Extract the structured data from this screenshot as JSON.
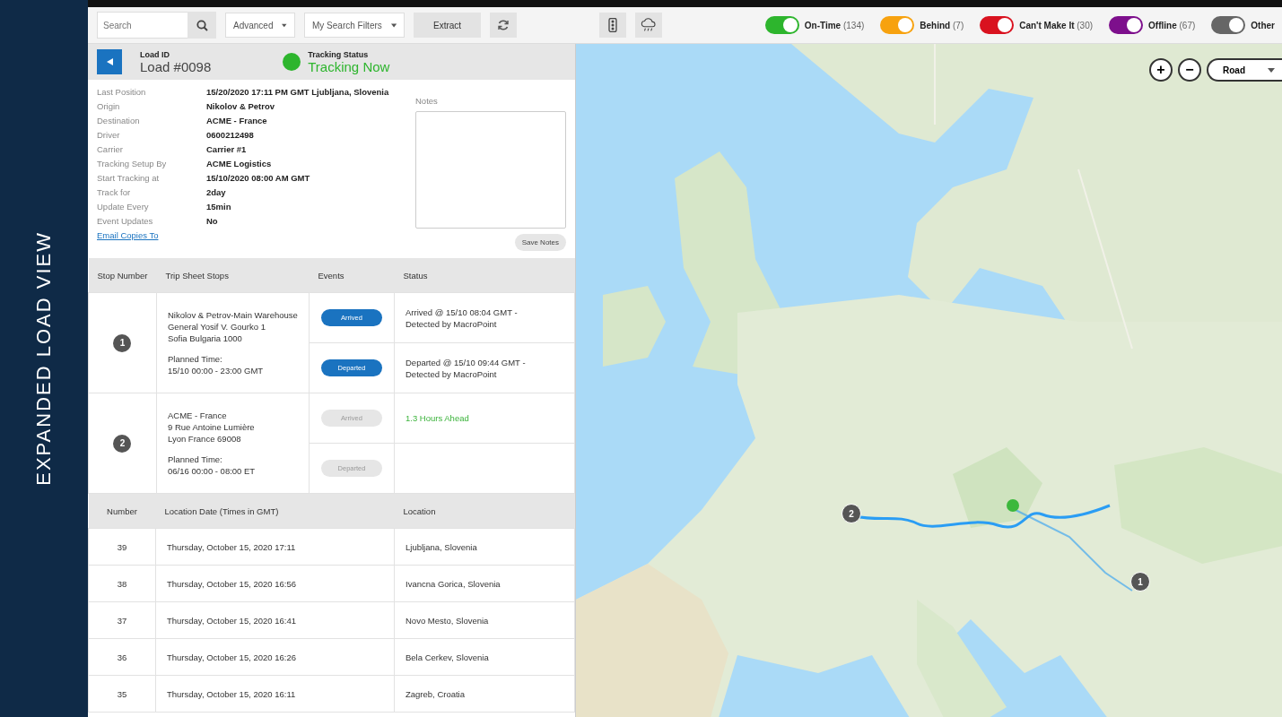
{
  "side_label": "EXPANDED LOAD VIEW",
  "toolbar": {
    "search": {
      "placeholder": "Search"
    },
    "dropdowns": [
      "Advanced",
      "My Search Filters"
    ],
    "extract": "Extract",
    "filters": [
      {
        "label": "On-Time",
        "count": "(134)",
        "color": "#2db52d",
        "on": true
      },
      {
        "label": "Behind",
        "count": "(7)",
        "color": "#f7a20f",
        "on": true
      },
      {
        "label": "Can't Make It",
        "count": "(30)",
        "color": "#d9121f",
        "on": true
      },
      {
        "label": "Offline",
        "count": "(67)",
        "color": "#7d0f8c",
        "on": true
      },
      {
        "label": "Other",
        "color": "#666666",
        "on": true
      }
    ]
  },
  "load": {
    "id_label": "Load ID",
    "id": "Load #0098",
    "status_label": "Tracking Status",
    "status": "Tracking Now",
    "details": [
      {
        "label": "Last Position",
        "value": "15/20/2020 17:11 PM GMT Ljubljana, Slovenia"
      },
      {
        "label": "Origin",
        "value": "Nikolov & Petrov"
      },
      {
        "label": "Destination",
        "value": "ACME - France"
      },
      {
        "label": "Driver",
        "value": "0600212498"
      },
      {
        "label": "Carrier",
        "value": "Carrier #1"
      },
      {
        "label": "Tracking Setup By",
        "value": "ACME Logistics"
      },
      {
        "label": "Start Tracking at",
        "value": "15/10/2020 08:00 AM GMT"
      },
      {
        "label": "Track for",
        "value": "2day"
      },
      {
        "label": "Update Every",
        "value": "15min"
      },
      {
        "label": "Event Updates",
        "value": "No"
      }
    ],
    "email_link": "Email Copies To",
    "notes_label": "Notes",
    "save_notes": "Save Notes"
  },
  "stops": {
    "columns": [
      "Stop Number",
      "Trip Sheet Stops",
      "Events",
      "Status"
    ],
    "rows": [
      {
        "number": "1",
        "address": [
          "Nikolov & Petrov-Main Warehouse",
          "General Yosif V. Gourko 1",
          "Sofia Bulgaria 1000"
        ],
        "planned": [
          "Planned Time:",
          "15/10 00:00 - 23:00 GMT"
        ],
        "events": [
          {
            "label": "Arrived",
            "done": true,
            "status": "Arrived @ 15/10 08:04 GMT - Detected by MacroPoint",
            "kind": "detected"
          },
          {
            "label": "Departed",
            "done": true,
            "status": "Departed @ 15/10 09:44 GMT - Detected by MacroPoint",
            "kind": "detected"
          }
        ]
      },
      {
        "number": "2",
        "address": [
          "ACME - France",
          "9 Rue Antoine Lumière",
          "Lyon France 69008"
        ],
        "planned": [
          "Planned Time:",
          "06/16 00:00 - 08:00 ET"
        ],
        "events": [
          {
            "label": "Arrived",
            "done": false,
            "status": "1.3 Hours Ahead",
            "kind": "ahead"
          },
          {
            "label": "Departed",
            "done": false
          }
        ]
      }
    ]
  },
  "locations": {
    "columns": [
      "Number",
      "Location Date (Times in GMT)",
      "Location"
    ],
    "rows": [
      [
        "39",
        "Thursday, October 15, 2020 17:11",
        "Ljubljana, Slovenia"
      ],
      [
        "38",
        "Thursday, October 15, 2020 16:56",
        "Ivancna Gorica, Slovenia"
      ],
      [
        "37",
        "Thursday, October 15, 2020 16:41",
        "Novo Mesto, Slovenia"
      ],
      [
        "36",
        "Thursday, October 15, 2020 16:26",
        "Bela Cerkev, Slovenia"
      ],
      [
        "35",
        "Thursday, October 15, 2020 16:11",
        "Zagreb, Croatia"
      ]
    ]
  },
  "map": {
    "kind": "picture",
    "zoom_in": "+",
    "zoom_out": "−",
    "map_type": "Road",
    "markers": [
      "2",
      "1"
    ]
  }
}
